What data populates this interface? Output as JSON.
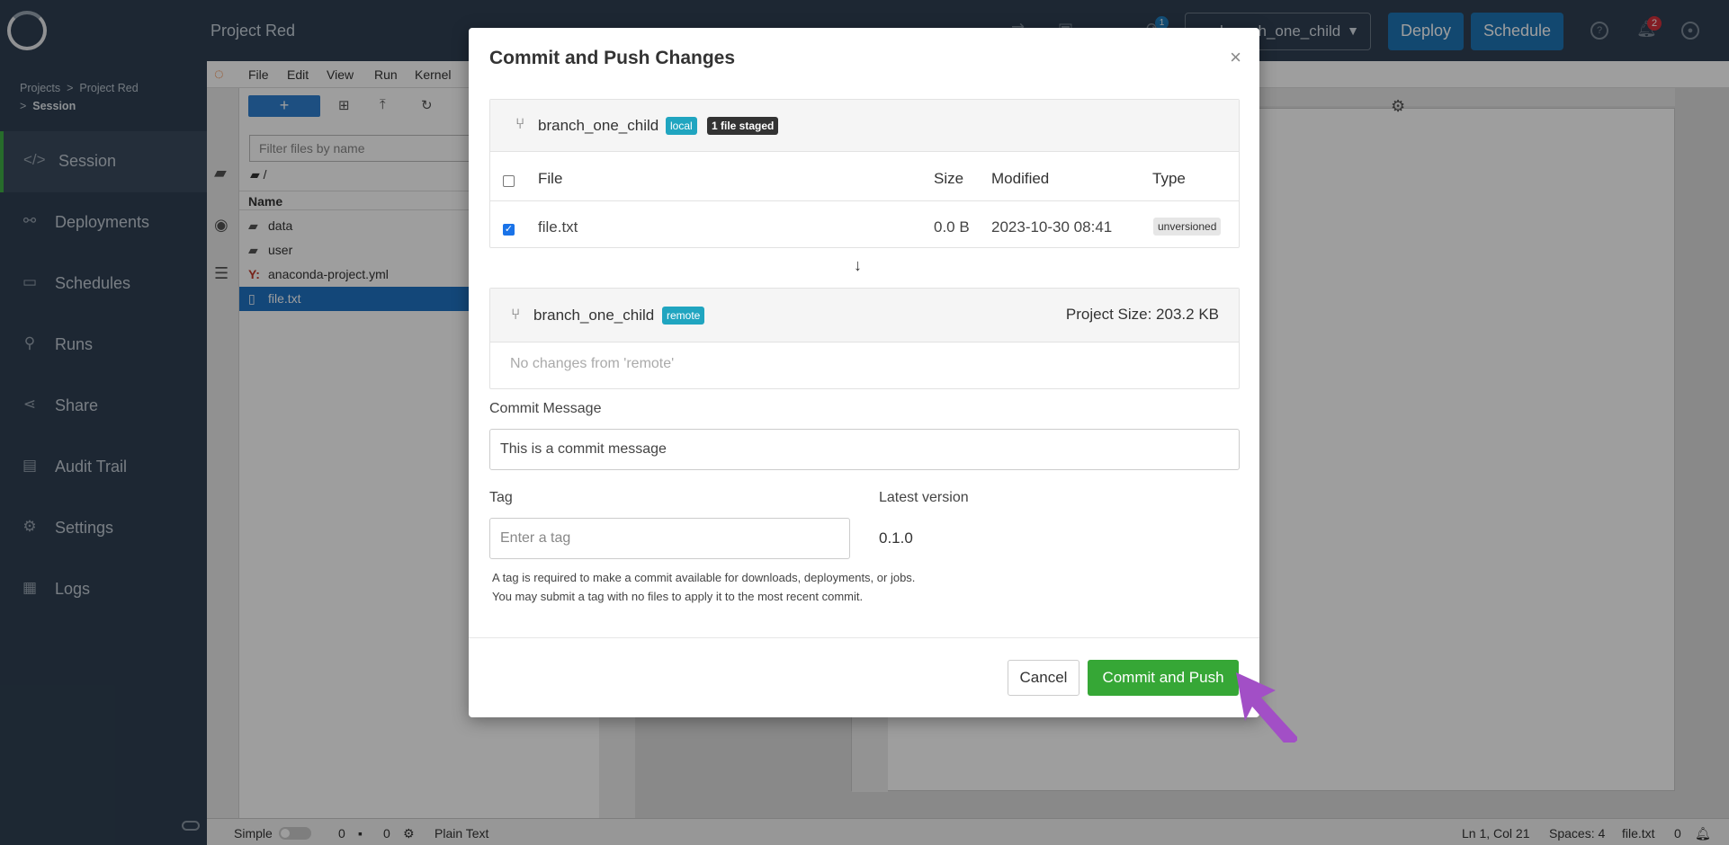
{
  "app": {
    "project_title": "Project Red",
    "branch_select": "branch_one_child",
    "deploy_label": "Deploy",
    "schedule_label": "Schedule",
    "deploy_badge": "1",
    "notif_badge": "2"
  },
  "breadcrumb": {
    "projects": "Projects",
    "sep": ">",
    "project": "Project Red",
    "session": "Session"
  },
  "nav": [
    {
      "label": "Session",
      "icon": "code-icon"
    },
    {
      "label": "Deployments",
      "icon": "nodes-icon"
    },
    {
      "label": "Schedules",
      "icon": "calendar-icon"
    },
    {
      "label": "Runs",
      "icon": "bicycle-icon"
    },
    {
      "label": "Share",
      "icon": "share-icon"
    },
    {
      "label": "Audit Trail",
      "icon": "document-icon"
    },
    {
      "label": "Settings",
      "icon": "gears-icon"
    },
    {
      "label": "Logs",
      "icon": "logs-icon"
    }
  ],
  "ide": {
    "menus": [
      "File",
      "Edit",
      "View",
      "Run",
      "Kernel"
    ],
    "new_label": "+",
    "filter_placeholder": "Filter files by name",
    "path": "/",
    "name_header": "Name",
    "files": [
      {
        "name": "data",
        "type": "folder"
      },
      {
        "name": "user",
        "type": "folder"
      },
      {
        "name": "anaconda-project.yml",
        "type": "yaml"
      },
      {
        "name": "file.txt",
        "type": "file"
      }
    ],
    "status": {
      "mode": "Simple",
      "count1": "0",
      "count2": "0",
      "filetype": "Plain Text",
      "position": "Ln 1, Col 21",
      "spaces": "Spaces: 4",
      "filename": "file.txt",
      "count3": "0"
    }
  },
  "modal": {
    "title": "Commit and Push Changes",
    "close": "×",
    "local": {
      "branch": "branch_one_child",
      "badge": "local",
      "staged": "1 file staged",
      "headers": {
        "file": "File",
        "size": "Size",
        "modified": "Modified",
        "type": "Type"
      },
      "rows": [
        {
          "file": "file.txt",
          "size": "0.0 B",
          "modified": "2023-10-30 08:41",
          "type": "unversioned"
        }
      ]
    },
    "arrow": "↓",
    "remote": {
      "branch": "branch_one_child",
      "badge": "remote",
      "project_size": "Project Size: 203.2 KB",
      "no_changes": "No changes from 'remote'"
    },
    "commit_label": "Commit Message",
    "commit_value": "This is a commit message",
    "tag_label": "Tag",
    "tag_placeholder": "Enter a tag",
    "latest_label": "Latest version",
    "latest_value": "0.1.0",
    "help_line1": "A tag is required to make a commit available for downloads, deployments, or jobs.",
    "help_line2": "You may submit a tag with no files to apply it to the most recent commit.",
    "cancel": "Cancel",
    "commit_push": "Commit and Push"
  }
}
